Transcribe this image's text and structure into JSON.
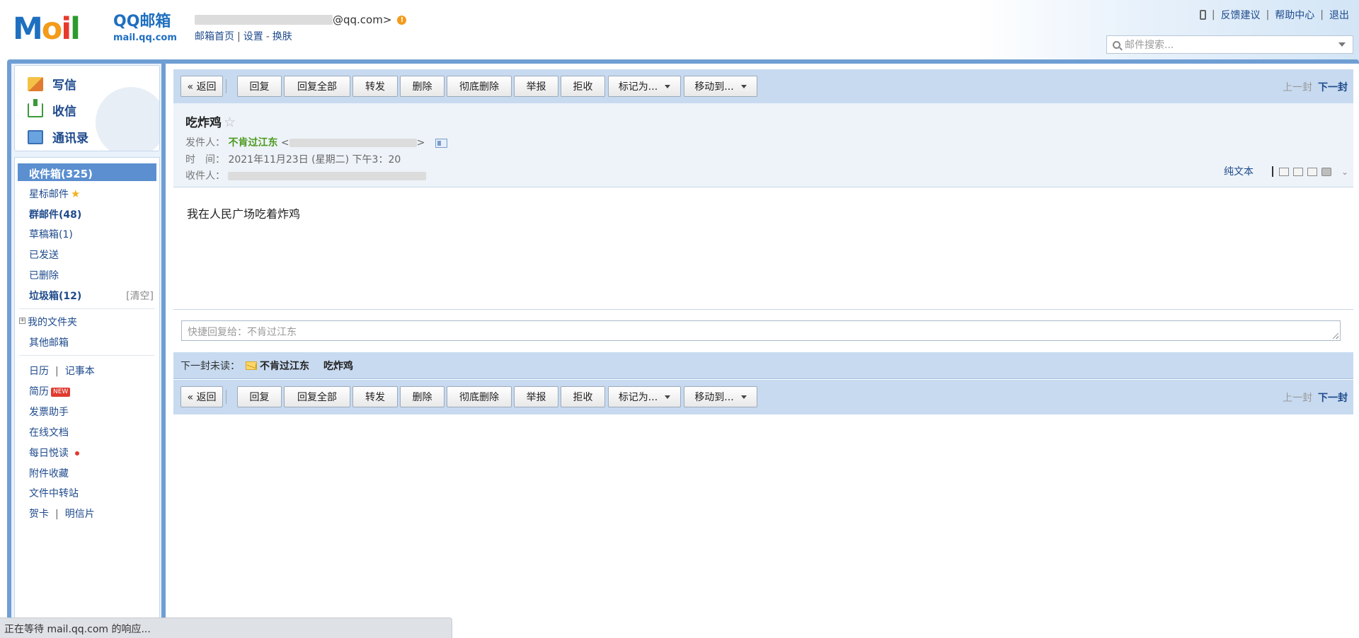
{
  "header": {
    "logo_text": "Mail",
    "logo_qq": "QQ邮箱",
    "logo_url": "mail.qq.com",
    "account_suffix": "@qq.com>",
    "links": [
      "邮箱首页",
      "设置",
      "换肤"
    ],
    "right_links": [
      "反馈建议",
      "帮助中心",
      "退出"
    ],
    "search_placeholder": "邮件搜索..."
  },
  "quick_actions": [
    "写信",
    "收信",
    "通讯录"
  ],
  "folders": {
    "inbox": "收件箱(325)",
    "starred": "星标邮件",
    "group": "群邮件(48)",
    "drafts": "草稿箱(1)",
    "sent": "已发送",
    "deleted": "已删除",
    "spam": "垃圾箱(12)",
    "spam_clear": "[清空]",
    "my_folders": "我的文件夹",
    "other_mailbox": "其他邮箱",
    "calendar": "日历",
    "notebook": "记事本",
    "resume": "简历",
    "resume_badge": "NEW",
    "invoice": "发票助手",
    "docs": "在线文档",
    "daily_read": "每日悦读",
    "attachments": "附件收藏",
    "transfer": "文件中转站",
    "greeting_card": "贺卡",
    "postcard": "明信片"
  },
  "toolbar": {
    "back": "« 返回",
    "reply": "回复",
    "reply_all": "回复全部",
    "forward": "转发",
    "delete": "删除",
    "delete_permanent": "彻底删除",
    "report": "举报",
    "reject": "拒收",
    "mark_as": "标记为...",
    "move_to": "移动到...",
    "prev": "上一封",
    "next": "下一封"
  },
  "mail": {
    "subject": "吃炸鸡",
    "from_label": "发件人：",
    "from_name": "不肯过江东",
    "from_email_open": "<",
    "from_email_close": ">",
    "time_label": "时　间：",
    "time_value": "2021年11月23日 (星期二) 下午3：20",
    "to_label": "收件人：",
    "plain_text": "纯文本",
    "body": "我在人民广场吃着炸鸡"
  },
  "quick_reply": {
    "placeholder": "快捷回复给：不肯过江东"
  },
  "next_unread": {
    "label": "下一封未读：",
    "sender": "不肯过江东",
    "subject": "吃炸鸡"
  },
  "status_bar": "正在等待 mail.qq.com 的响应..."
}
